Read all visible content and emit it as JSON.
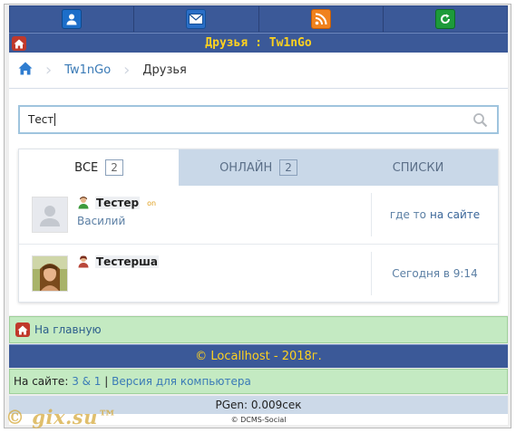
{
  "topnav": {
    "items": [
      {
        "icon": "user-icon"
      },
      {
        "icon": "mail-icon"
      },
      {
        "icon": "rss-icon"
      },
      {
        "icon": "refresh-icon"
      }
    ]
  },
  "title": "Друзья : Tw1nGo",
  "breadcrumb": {
    "home_icon": "home-icon",
    "link": "Tw1nGo",
    "current": "Друзья"
  },
  "search": {
    "value": "Тест"
  },
  "tabs": [
    {
      "label": "ВСЕ",
      "count": "2"
    },
    {
      "label": "ОНЛАЙН",
      "count": "2"
    },
    {
      "label": "СПИСКИ"
    }
  ],
  "friends": [
    {
      "name": "Тестер",
      "online_badge": "on",
      "subtitle": "Василий",
      "status_prefix": "где то",
      "status_highlight": "на сайте"
    },
    {
      "name": "Тестерша",
      "status": "Сегодня в 9:14"
    }
  ],
  "footer": {
    "home_link": "На главную",
    "copyright": "© Locallhost - 2018г.",
    "online_label": "На сайте:",
    "online_counts": "3 & 1",
    "divider": "|",
    "desktop_link": "Версия для компьютера",
    "pgen": "PGen: 0.009сек",
    "credit": "© DCMS-Social"
  },
  "watermark": "© gix.su™",
  "colors": {
    "header_blue": "#3b5998",
    "title_yellow": "#ffd21f",
    "footer_green": "#c4eac2",
    "tab_inactive": "#c9d8e8"
  }
}
